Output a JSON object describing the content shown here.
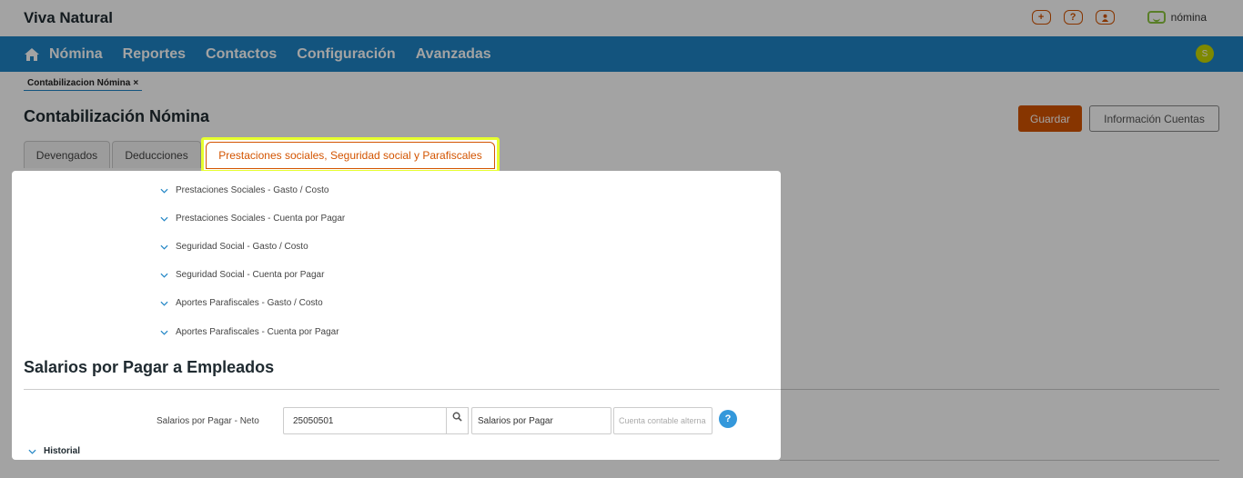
{
  "header": {
    "company": "Viva Natural",
    "icons": [
      "plus-icon",
      "help-icon",
      "user-icon"
    ],
    "logo_text": "nómina"
  },
  "nav": {
    "items": [
      "Nómina",
      "Reportes",
      "Contactos",
      "Configuración",
      "Avanzadas"
    ],
    "badge": "S"
  },
  "breadcrumb": {
    "tab_label": "Contabilizacion Nómina",
    "close": "×"
  },
  "page": {
    "title": "Contabilización Nómina",
    "guardar_label": "Guardar",
    "info_label": "Información Cuentas"
  },
  "tabs": {
    "devengados": "Devengados",
    "deducciones": "Deducciones",
    "prestaciones": "Prestaciones sociales, Seguridad social y Parafiscales"
  },
  "accordion": {
    "items": [
      "Prestaciones Sociales - Gasto / Costo",
      "Prestaciones Sociales - Cuenta por Pagar",
      "Seguridad Social - Gasto / Costo",
      "Seguridad Social - Cuenta por Pagar",
      "Aportes Parafiscales - Gasto / Costo",
      "Aportes Parafiscales - Cuenta por Pagar"
    ]
  },
  "salarios": {
    "title": "Salarios por Pagar a Empleados",
    "field_label": "Salarios por Pagar - Neto",
    "code_value": "25050501",
    "name_value": "Salarios por Pagar",
    "alt_placeholder": "Cuenta contable alterna",
    "help": "?",
    "historial": "Historial"
  },
  "colors": {
    "brand_blue": "#1f84c5",
    "accent_orange": "#d35400",
    "highlight_yellow": "#e6ff2e",
    "logo_green": "#8cc63f",
    "help_blue": "#3498db"
  }
}
